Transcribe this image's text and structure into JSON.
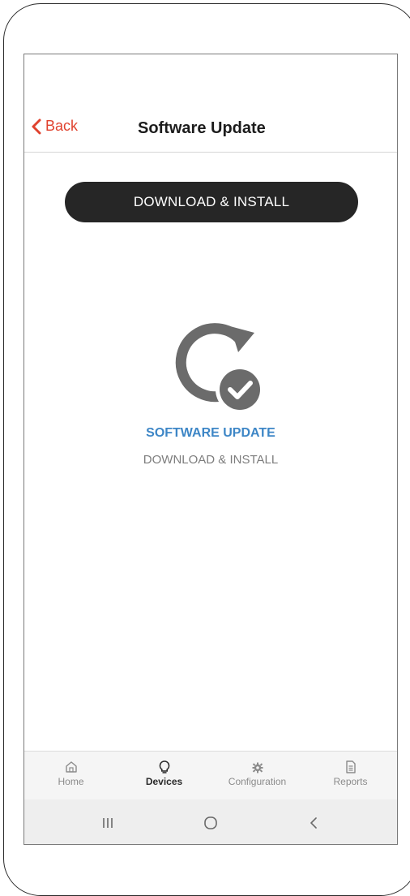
{
  "header": {
    "back_label": "Back",
    "title": "Software Update"
  },
  "primary_action": {
    "label": "DOWNLOAD & INSTALL"
  },
  "hero": {
    "icon": "refresh-check-icon",
    "title": "SOFTWARE UPDATE",
    "subtitle": "DOWNLOAD & INSTALL"
  },
  "tabbar": {
    "items": [
      {
        "label": "Home",
        "icon": "home-icon",
        "active": false
      },
      {
        "label": "Devices",
        "icon": "lightbulb-icon",
        "active": true
      },
      {
        "label": "Configuration",
        "icon": "gear-icon",
        "active": false
      },
      {
        "label": "Reports",
        "icon": "document-icon",
        "active": false
      }
    ]
  },
  "system_nav": {
    "items": [
      "recent-apps-icon",
      "home-circle-icon",
      "back-chevron-icon"
    ]
  },
  "colors": {
    "accent_red": "#e0422e",
    "button_dark": "#262626",
    "hero_blue": "#3d86c6",
    "icon_gray": "#6b6b6b"
  }
}
